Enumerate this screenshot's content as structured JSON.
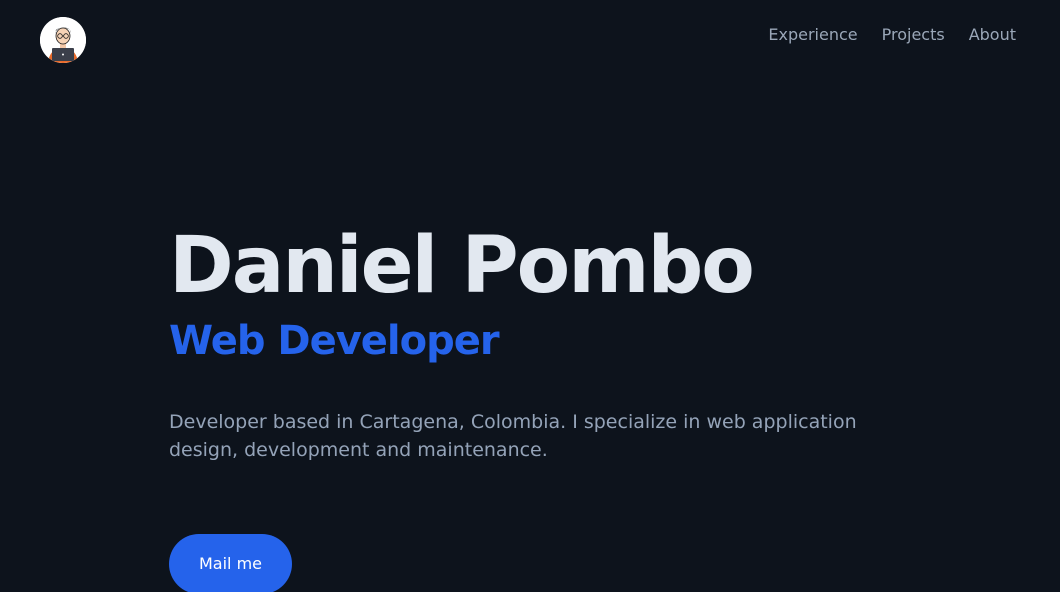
{
  "header": {
    "avatar_icon": "developer-avatar-icon",
    "nav": [
      {
        "label": "Experience"
      },
      {
        "label": "Projects"
      },
      {
        "label": "About"
      }
    ]
  },
  "hero": {
    "name": "Daniel Pombo",
    "role": "Web Developer",
    "description": "Developer based in Cartagena, Colombia. I specialize in web application design, development and maintenance.",
    "cta_label": "Mail me"
  },
  "colors": {
    "background": "#0d131c",
    "accent": "#2563eb",
    "heading": "#e2e8f0",
    "muted": "#94a3b8"
  }
}
